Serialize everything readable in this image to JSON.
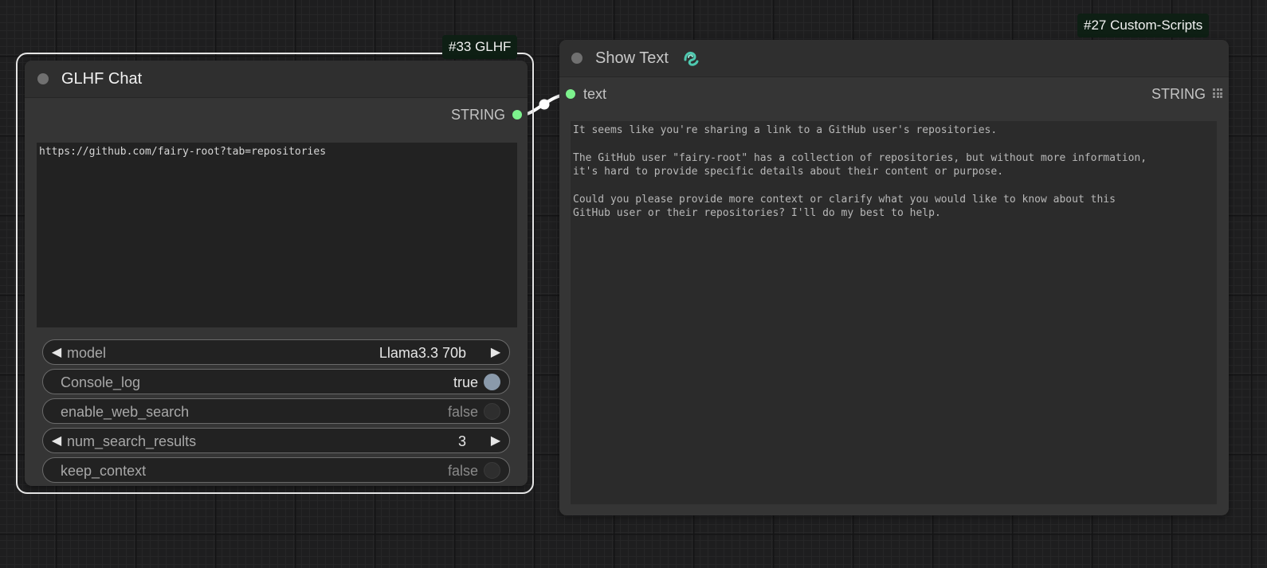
{
  "glhf_node": {
    "badge": "#33 GLHF",
    "title": "GLHF Chat",
    "output_label": "STRING",
    "prompt_text": "https://github.com/fairy-root?tab=repositories",
    "widgets": {
      "model": {
        "label": "model",
        "value": "Llama3.3 70b"
      },
      "console_log": {
        "label": "Console_log",
        "value": "true",
        "enabled": true
      },
      "enable_web_search": {
        "label": "enable_web_search",
        "value": "false",
        "enabled": false
      },
      "num_search_results": {
        "label": "num_search_results",
        "value": "3"
      },
      "keep_context": {
        "label": "keep_context",
        "value": "false",
        "enabled": false
      }
    }
  },
  "show_text_node": {
    "badge": "#27 Custom-Scripts",
    "title": "Show Text",
    "title_icon": "custom-scripts-snake-icon",
    "input_label": "text",
    "output_label": "STRING",
    "output_text": "It seems like you're sharing a link to a GitHub user's repositories.\n\nThe GitHub user \"fairy-root\" has a collection of repositories, but without more information,\nit's hard to provide specific details about their content or purpose.\n\nCould you please provide more context or clarify what you would like to know about this\nGitHub user or their repositories? I'll do my best to help."
  },
  "colors": {
    "connection": "#ffffff",
    "slot_string": "#7df28d",
    "badge_bg": "#0e1f14",
    "node_bg": "#353535",
    "canvas_bg": "#1e1e1f"
  }
}
